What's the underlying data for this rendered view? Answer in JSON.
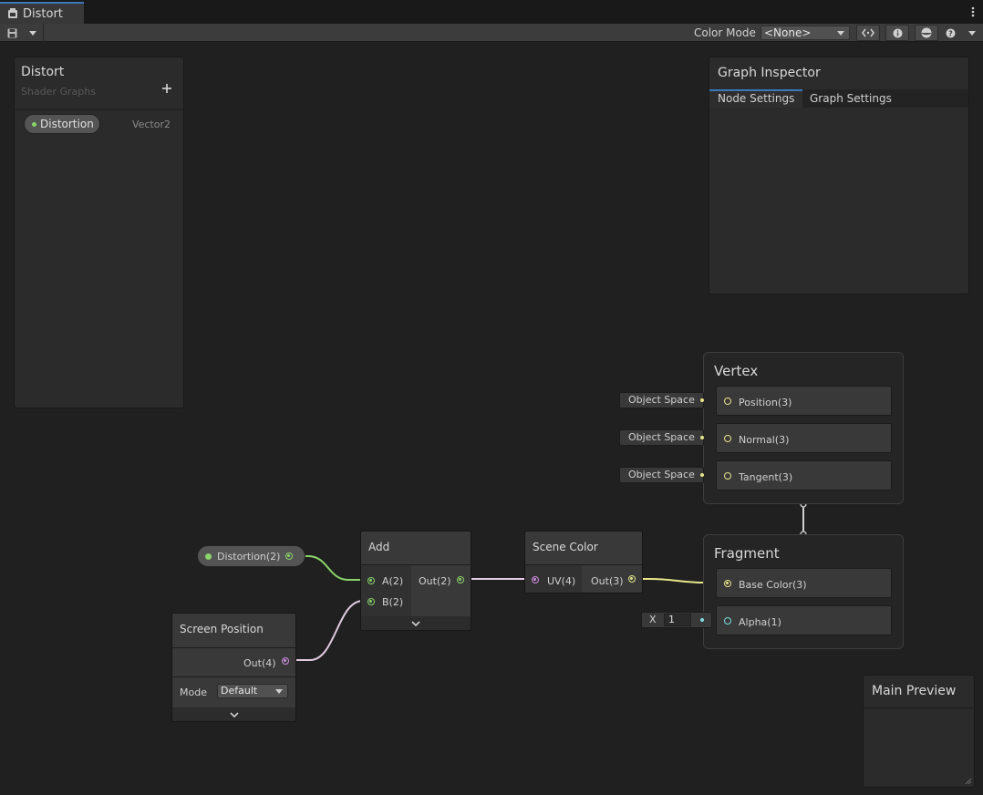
{
  "window": {
    "tab_title": "Distort"
  },
  "toolbar": {
    "color_mode_label": "Color Mode",
    "color_mode_value": "<None>"
  },
  "blackboard": {
    "title": "Distort",
    "subtitle": "Shader Graphs",
    "properties": [
      {
        "name": "Distortion",
        "type": "Vector2"
      }
    ]
  },
  "inspector": {
    "title": "Graph Inspector",
    "tabs": [
      {
        "label": "Node Settings",
        "active": true
      },
      {
        "label": "Graph Settings",
        "active": false
      }
    ]
  },
  "preview": {
    "title": "Main Preview"
  },
  "nodes": {
    "distortion_property": {
      "label": "Distortion(2)"
    },
    "add": {
      "title": "Add",
      "inputs": [
        "A(2)",
        "B(2)"
      ],
      "output": "Out(2)"
    },
    "scene_color": {
      "title": "Scene Color",
      "input": "UV(4)",
      "output": "Out(3)"
    },
    "screen_position": {
      "title": "Screen Position",
      "output": "Out(4)",
      "mode_label": "Mode",
      "mode_value": "Default"
    }
  },
  "vertex": {
    "title": "Vertex",
    "blocks": [
      {
        "label": "Position(3)",
        "space": "Object Space"
      },
      {
        "label": "Normal(3)",
        "space": "Object Space"
      },
      {
        "label": "Tangent(3)",
        "space": "Object Space"
      }
    ]
  },
  "fragment": {
    "title": "Fragment",
    "blocks": [
      {
        "label": "Base Color(3)"
      },
      {
        "label": "Alpha(1)",
        "field_label": "X",
        "field_value": "1"
      }
    ]
  },
  "colors": {
    "vector2": "#8ad46a",
    "vector4": "#d08fe0",
    "vector3": "#e6e68a",
    "float": "#7fdde0",
    "accent": "#3a79bb"
  }
}
